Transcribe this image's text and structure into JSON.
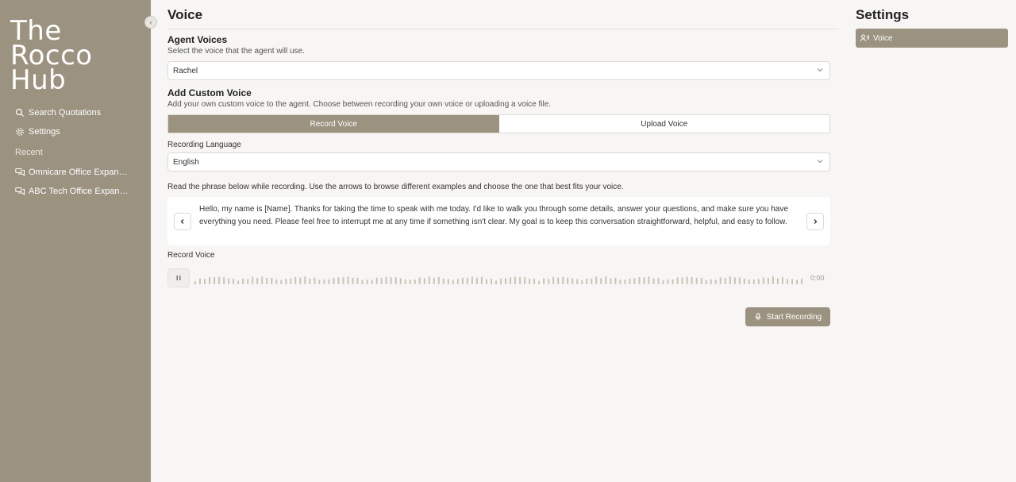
{
  "sidebar": {
    "brand_line1": "The",
    "brand_line2": "Rocco",
    "brand_line3": "Hub",
    "collapse_icon": "chevron-left-icon",
    "nav": [
      {
        "label": "Search Quotations",
        "icon": "search-icon"
      },
      {
        "label": "Settings",
        "icon": "gear-icon"
      }
    ],
    "recent_label": "Recent",
    "recent": [
      {
        "label": "Omnicare Office Expansion",
        "icon": "chat-icon"
      },
      {
        "label": "ABC Tech Office Expansion",
        "icon": "chat-icon"
      }
    ]
  },
  "main": {
    "title": "Voice",
    "agent_voices": {
      "title": "Agent Voices",
      "subtitle": "Select the voice that the agent will use.",
      "selected": "Rachel"
    },
    "custom_voice": {
      "title": "Add Custom Voice",
      "subtitle": "Add your own custom voice to the agent. Choose between recording your own voice or uploading a voice file.",
      "tabs": [
        "Record Voice",
        "Upload Voice"
      ],
      "active_tab": "Record Voice"
    },
    "recording_language": {
      "label": "Recording Language",
      "selected": "English"
    },
    "instructions": "Read the phrase below while recording. Use the arrows to browse different examples and choose the one that best fits your voice.",
    "phrase": "Hello, my name is [Name]. Thanks for taking the time to speak with me today. I'd like to walk you through some details, answer your questions, and make sure you have everything you need. Please feel free to interrupt me at any time if something isn't clear. My goal is to keep this conversation straightforward, helpful, and easy to follow.",
    "record_label": "Record Voice",
    "timer": "0:00",
    "start_button": "Start Recording"
  },
  "settings": {
    "title": "Settings",
    "items": [
      {
        "label": "Voice",
        "icon": "voice-icon"
      }
    ]
  },
  "colors": {
    "accent": "#9b9280",
    "background": "#f7f6f4"
  }
}
